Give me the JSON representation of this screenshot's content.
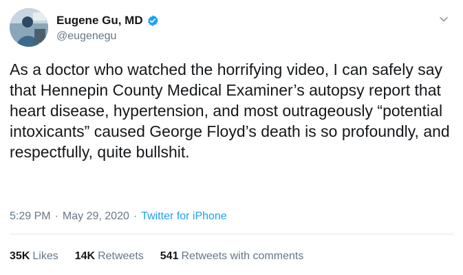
{
  "user": {
    "display_name": "Eugene Gu, MD",
    "handle": "@eugenegu",
    "verified": true
  },
  "tweet": {
    "text": "As a doctor who watched the horrifying video, I can safely say that Hennepin County Medical Examiner’s autopsy report that heart disease, hypertension, and most outrageously “potential intoxicants” caused George Floyd’s death is so profoundly, and respectfully, quite bullshit."
  },
  "meta": {
    "time": "5:29 PM",
    "separator": "·",
    "date": "May 29, 2020",
    "source": "Twitter for iPhone"
  },
  "stats": {
    "likes_count": "35K",
    "likes_label": "Likes",
    "retweets_count": "14K",
    "retweets_label": "Retweets",
    "comments_count": "541",
    "comments_label": "Retweets with comments"
  },
  "colors": {
    "verified_blue": "#1da1f2",
    "link_blue": "#1da1f2",
    "secondary_text": "#657786"
  },
  "icons": [
    "verified-badge-icon",
    "chevron-down-icon",
    "avatar"
  ]
}
